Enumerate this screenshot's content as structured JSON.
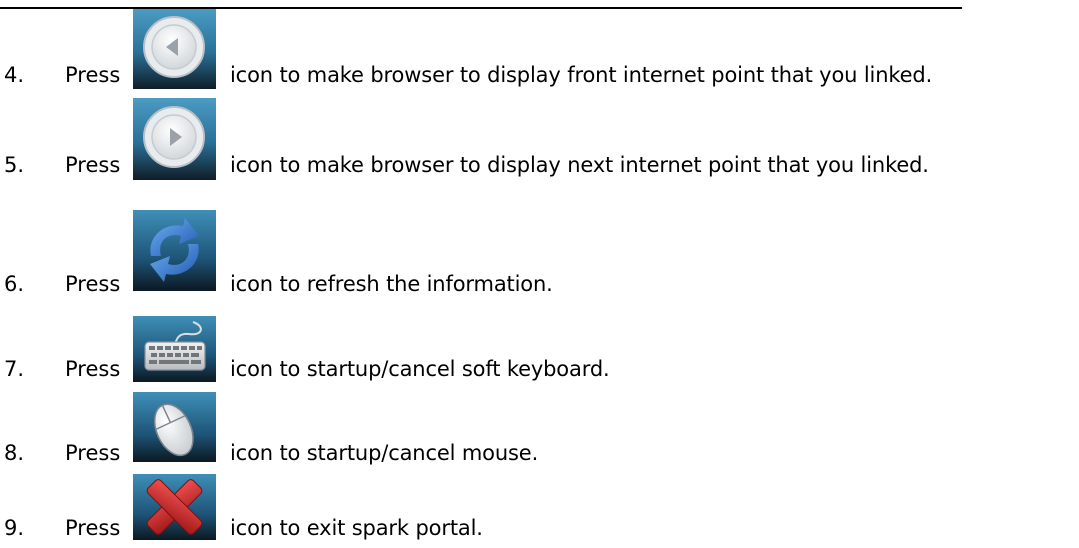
{
  "steps": [
    {
      "number": "4.",
      "press": "Press",
      "icon": "back-arrow-icon",
      "text": "icon to make browser to display front internet point that you linked."
    },
    {
      "number": "5.",
      "press": "Press",
      "icon": "forward-arrow-icon",
      "text": "icon to make browser to display next internet point that you linked."
    },
    {
      "number": "6.",
      "press": "Press",
      "icon": "refresh-icon",
      "text": "icon to refresh the information."
    },
    {
      "number": "7.",
      "press": "Press",
      "icon": "keyboard-icon",
      "text": "icon to startup/cancel soft keyboard."
    },
    {
      "number": "8.",
      "press": "Press",
      "icon": "mouse-icon",
      "text": "icon to startup/cancel mouse."
    },
    {
      "number": "9.",
      "press": "Press",
      "icon": "close-icon",
      "text": "icon to exit spark portal."
    }
  ],
  "colors": {
    "icon_bg_top": "#3f8fb8",
    "icon_bg_bottom": "#10202c",
    "refresh_blue": "#3a7fd0",
    "close_red": "#d42a2a"
  }
}
